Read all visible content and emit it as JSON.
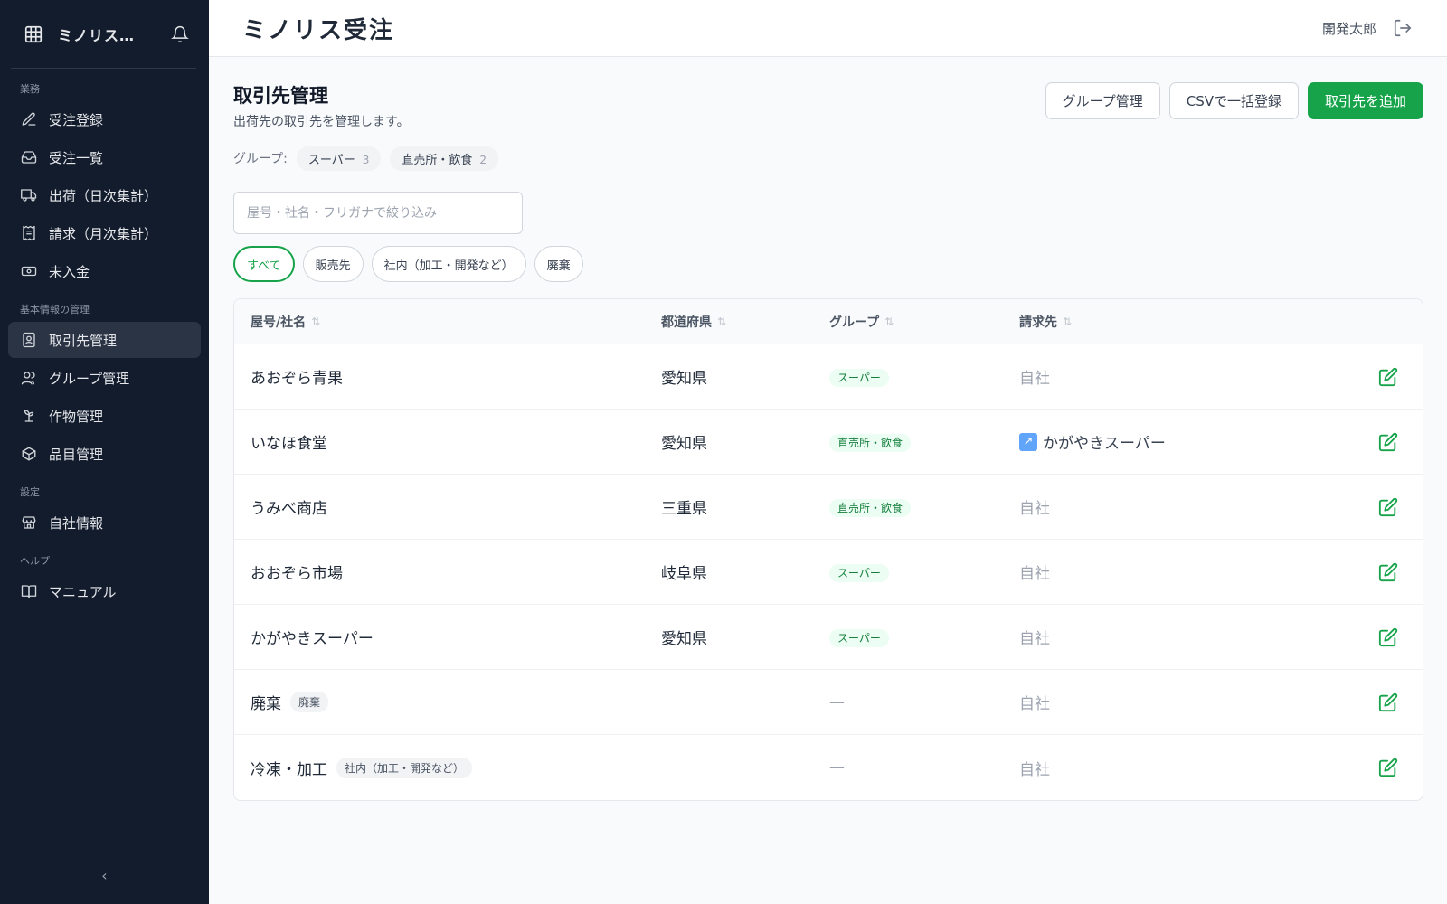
{
  "app": {
    "name": "ミノリス…",
    "title": "ミノリス受注",
    "user": "開発太郎"
  },
  "sidebar": {
    "sections": [
      {
        "label": "業務",
        "items": [
          {
            "label": "受注登録",
            "icon": "edit-icon"
          },
          {
            "label": "受注一覧",
            "icon": "inbox-icon"
          },
          {
            "label": "出荷（日次集計）",
            "icon": "truck-icon"
          },
          {
            "label": "請求（月次集計）",
            "icon": "receipt-icon"
          },
          {
            "label": "未入金",
            "icon": "banknote-icon"
          }
        ]
      },
      {
        "label": "基本情報の管理",
        "items": [
          {
            "label": "取引先管理",
            "icon": "contact-book-icon",
            "active": true
          },
          {
            "label": "グループ管理",
            "icon": "users-icon"
          },
          {
            "label": "作物管理",
            "icon": "sprout-icon"
          },
          {
            "label": "品目管理",
            "icon": "package-icon"
          }
        ]
      },
      {
        "label": "設定",
        "items": [
          {
            "label": "自社情報",
            "icon": "store-icon"
          }
        ]
      },
      {
        "label": "ヘルプ",
        "items": [
          {
            "label": "マニュアル",
            "icon": "book-icon"
          }
        ]
      }
    ],
    "collapse": "‹"
  },
  "page": {
    "title": "取引先管理",
    "subtitle": "出荷先の取引先を管理します。",
    "group_label": "グループ:",
    "groups": [
      {
        "name": "スーパー",
        "count": "3"
      },
      {
        "name": "直売所・飲食",
        "count": "2"
      }
    ],
    "actions": {
      "group_manage": "グループ管理",
      "csv_import": "CSVで一括登録",
      "add": "取引先を追加"
    },
    "search_placeholder": "屋号・社名・フリガナで絞り込み",
    "filters": [
      "すべて",
      "販売先",
      "社内（加工・開発など）",
      "廃棄"
    ],
    "active_filter": "すべて"
  },
  "table": {
    "headers": {
      "name": "屋号/社名",
      "pref": "都道府県",
      "group": "グループ",
      "billing": "請求先"
    },
    "rows": [
      {
        "name": "あおぞら青果",
        "tag": "",
        "pref": "愛知県",
        "group": "スーパー",
        "billing": "自社",
        "billing_link": false
      },
      {
        "name": "いなほ食堂",
        "tag": "",
        "pref": "愛知県",
        "group": "直売所・飲食",
        "billing": "かがやきスーパー",
        "billing_link": true
      },
      {
        "name": "うみべ商店",
        "tag": "",
        "pref": "三重県",
        "group": "直売所・飲食",
        "billing": "自社",
        "billing_link": false
      },
      {
        "name": "おおぞら市場",
        "tag": "",
        "pref": "岐阜県",
        "group": "スーパー",
        "billing": "自社",
        "billing_link": false
      },
      {
        "name": "かがやきスーパー",
        "tag": "",
        "pref": "愛知県",
        "group": "スーパー",
        "billing": "自社",
        "billing_link": false
      },
      {
        "name": "廃棄",
        "tag": "廃棄",
        "pref": "",
        "group": "",
        "billing": "自社",
        "billing_link": false
      },
      {
        "name": "冷凍・加工",
        "tag": "社内（加工・開発など）",
        "pref": "",
        "group": "",
        "billing": "自社",
        "billing_link": false
      }
    ],
    "empty_group": "—"
  },
  "colors": {
    "sidebar_bg": "#131c2c",
    "accent": "#16a34a",
    "tag_green_bg": "#ecfdf3"
  }
}
